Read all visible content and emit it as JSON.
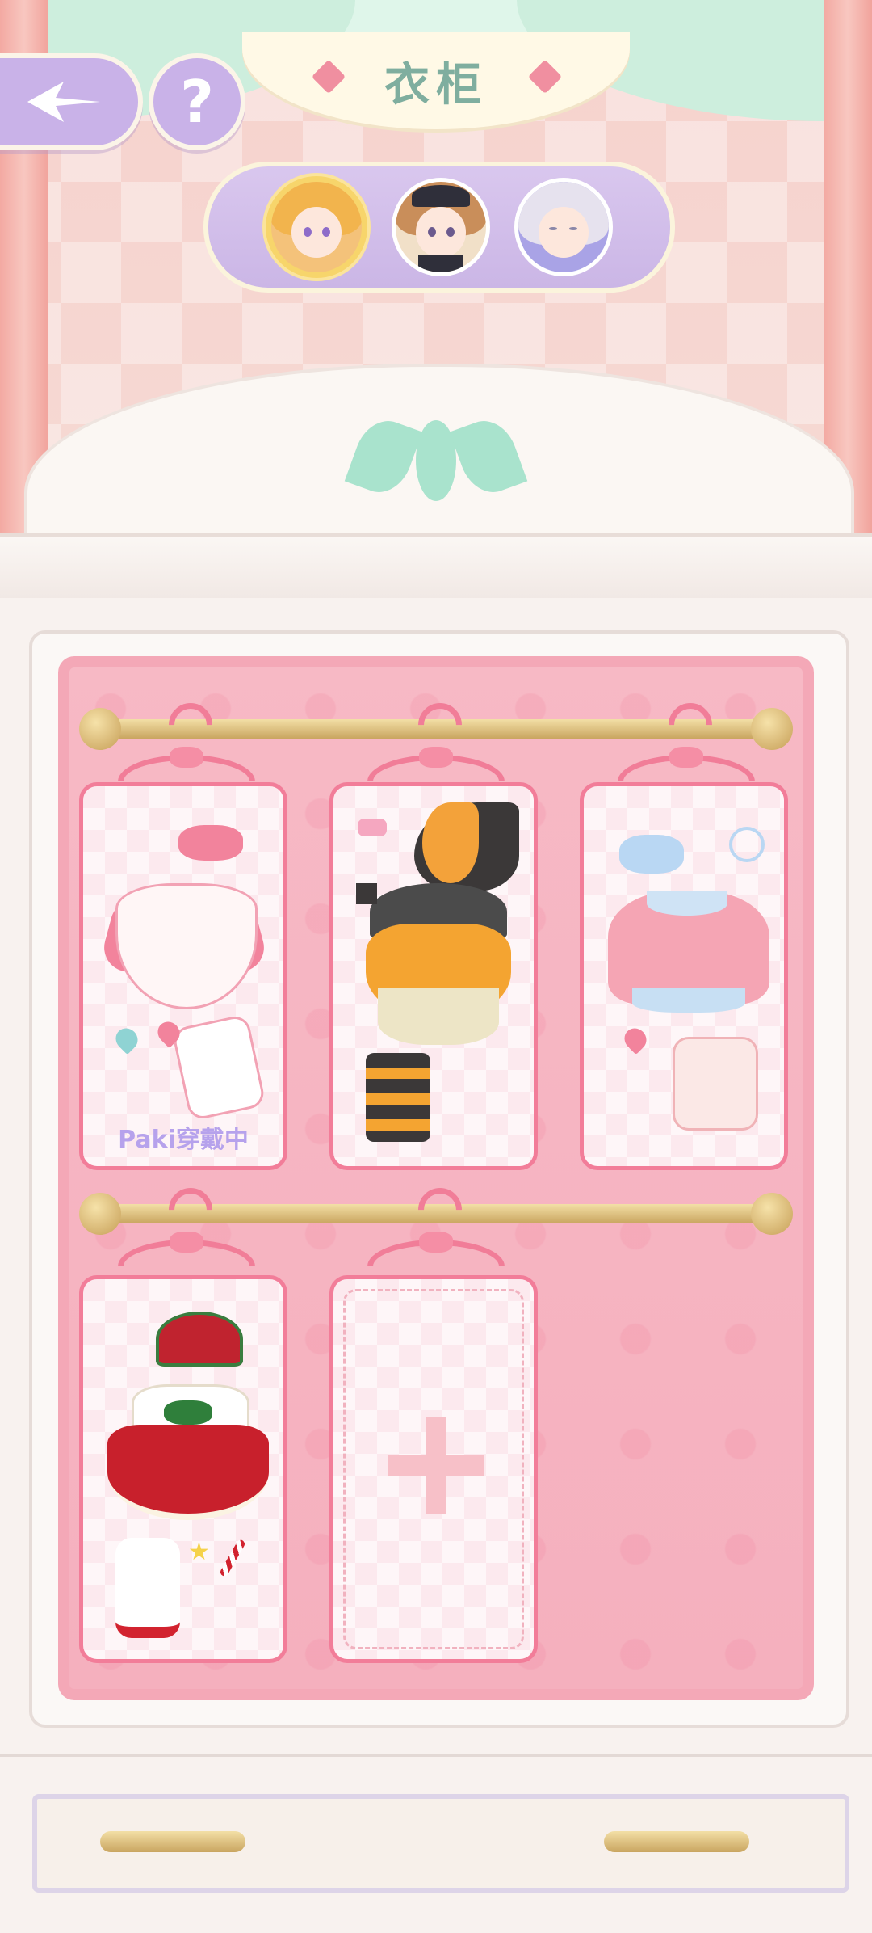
{
  "title": "衣柜",
  "header": {
    "back_icon": "back-arrow-icon",
    "help_label": "?"
  },
  "characters": [
    {
      "name": "blonde-girl",
      "selected": true
    },
    {
      "name": "brown-hair-girl-black-hat",
      "selected": false
    },
    {
      "name": "silver-hair-girl",
      "selected": false
    }
  ],
  "wardrobe": {
    "outfits": [
      {
        "name": "pink-white-dress-outfit",
        "label": "Paki穿戴中"
      },
      {
        "name": "witch-halloween-outfit",
        "label": ""
      },
      {
        "name": "pink-sweater-outfit",
        "label": ""
      },
      {
        "name": "christmas-red-dress-outfit",
        "label": ""
      }
    ],
    "empty_slot": {
      "name": "add-outfit-slot",
      "icon": "plus-icon"
    }
  },
  "colors": {
    "accent_purple": "#c9b2e8",
    "card_border": "#f27d99",
    "title_green": "#7fae9f",
    "selected_ring": "#f7d56b"
  }
}
